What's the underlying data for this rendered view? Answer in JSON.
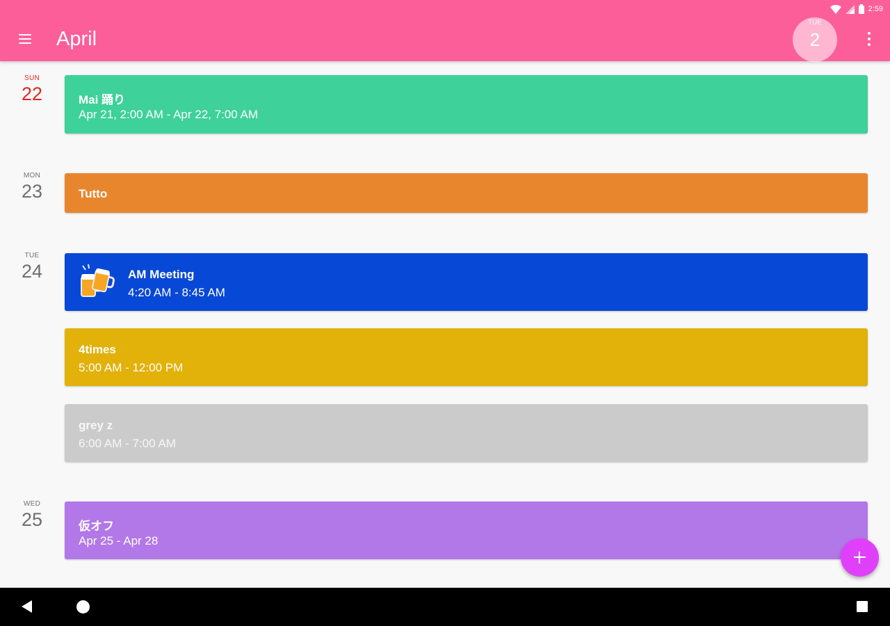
{
  "status_bar": {
    "time": "2:59"
  },
  "app_bar": {
    "title": "April",
    "today": {
      "dow": "TUE",
      "day": "2"
    }
  },
  "days": [
    {
      "dow": "SUN",
      "day": "22"
    },
    {
      "dow": "MON",
      "day": "23"
    },
    {
      "dow": "TUE",
      "day": "24"
    },
    {
      "dow": "WED",
      "day": "25"
    }
  ],
  "events": [
    {
      "title": "Mai 踊り",
      "time": "Apr 21, 2:00 AM - Apr 22, 7:00 AM",
      "color": "#3ed199"
    },
    {
      "title": "Tutto",
      "time": "",
      "color": "#e8862e"
    },
    {
      "title": "AM Meeting",
      "time": "4:20 AM - 8:45 AM",
      "color": "#0848d6",
      "icon": "beer-mugs-icon"
    },
    {
      "title": "4times",
      "time": "5:00 AM - 12:00 PM",
      "color": "#e2b10a"
    },
    {
      "title": "grey z",
      "time": "6:00 AM - 7:00 AM",
      "color": "#cbcbcb"
    },
    {
      "title": "仮オフ",
      "time": "Apr 25 - Apr 28",
      "color": "#b278e7"
    }
  ],
  "colors": {
    "app_bar": "#fc5e99",
    "today_accent": "#d82a20",
    "fab": "#e040fb"
  },
  "icons": {
    "menu": "hamburger-menu-icon",
    "more": "more-vert-icon",
    "fab": "plus-icon",
    "nav": [
      "back-icon",
      "home-icon",
      "recents-icon"
    ]
  }
}
